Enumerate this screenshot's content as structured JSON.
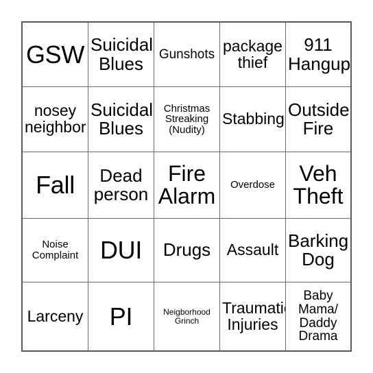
{
  "card": {
    "columns": 5,
    "rows": 5,
    "background_color": "#ffffff",
    "border_color": "#595959",
    "grid_line_color": "#6b6b6b",
    "text_color": "#000000",
    "cells": [
      {
        "text": "GSW",
        "size": "fs-xxl"
      },
      {
        "text": "Suicidal\nBlues",
        "size": "fs-lg"
      },
      {
        "text": "Gunshots",
        "size": "fs-sm"
      },
      {
        "text": "package\nthief",
        "size": "fs-md"
      },
      {
        "text": "911\nHangup",
        "size": "fs-lg"
      },
      {
        "text": "nosey\nneighbor",
        "size": "fs-md"
      },
      {
        "text": "Suicidal\nBlues",
        "size": "fs-lg"
      },
      {
        "text": "Christmas\nStreaking\n(Nudity)",
        "size": "fs-xs"
      },
      {
        "text": "Stabbing",
        "size": "fs-md"
      },
      {
        "text": "Outside\nFire",
        "size": "fs-lg"
      },
      {
        "text": "Fall",
        "size": "fs-xxl"
      },
      {
        "text": "Dead\nperson",
        "size": "fs-lg"
      },
      {
        "text": "Fire\nAlarm",
        "size": "fs-xl"
      },
      {
        "text": "Overdose",
        "size": "fs-xs"
      },
      {
        "text": "Veh\nTheft",
        "size": "fs-xl"
      },
      {
        "text": "Noise\nComplaint",
        "size": "fs-xs"
      },
      {
        "text": "DUI",
        "size": "fs-xxl"
      },
      {
        "text": "Drugs",
        "size": "fs-lg"
      },
      {
        "text": "Assault",
        "size": "fs-md"
      },
      {
        "text": "Barking\nDog",
        "size": "fs-lg"
      },
      {
        "text": "Larceny",
        "size": "fs-md"
      },
      {
        "text": "PI",
        "size": "fs-xxl"
      },
      {
        "text": "Neigborhood\nGrinch",
        "size": "fs-xxs"
      },
      {
        "text": "Traumatic\nInjuries",
        "size": "fs-md"
      },
      {
        "text": "Baby\nMama/\nDaddy\nDrama",
        "size": "fs-sm"
      }
    ]
  }
}
